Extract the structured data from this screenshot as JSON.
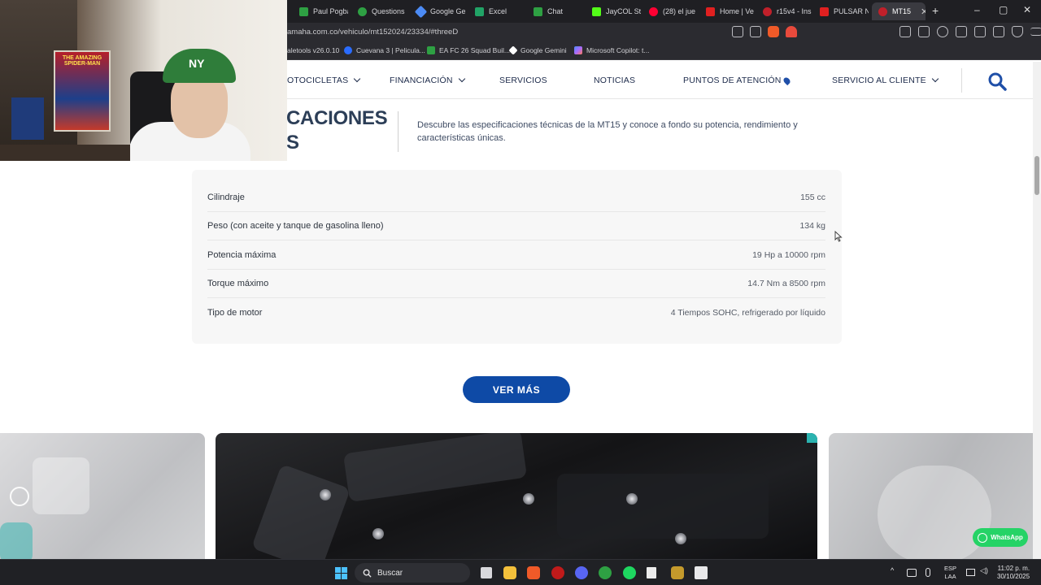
{
  "browser": {
    "tabs": [
      {
        "title": "Paul Pogba",
        "color": "#2ea043"
      },
      {
        "title": "Questions",
        "color": "#2ea043"
      },
      {
        "title": "Google Ge",
        "color": "#4c8bf5"
      },
      {
        "title": "Excel",
        "color": "#21a366"
      },
      {
        "title": "Chat",
        "color": "#2ea043"
      },
      {
        "title": "JayCOL St",
        "color": "#53fc18"
      },
      {
        "title": "(28) el jue",
        "color": "#ff0033"
      },
      {
        "title": "Home | Ve",
        "color": "#e02020"
      },
      {
        "title": "r15v4 - Ins",
        "color": "#c0202a"
      },
      {
        "title": "PULSAR N",
        "color": "#e02020"
      },
      {
        "title": "MT15",
        "color": "#c0202a"
      }
    ],
    "new_tab": "+",
    "url": "amaha.com.co/vehiculo/mt152024/23334/#threeD",
    "bookmarks": [
      {
        "label": "aletools v26.0.10",
        "color": "#4a8cff"
      },
      {
        "label": "Cuevana 3 | Pelicula...",
        "color": "#2a6cff"
      },
      {
        "label": "EA FC 26 Squad Buil...",
        "color": "#2ea043"
      },
      {
        "label": "Google Gemini",
        "color": "#ffffff"
      },
      {
        "label": "Microsoft Copilot: t...",
        "color": "#a86bff"
      }
    ]
  },
  "nav": {
    "items": [
      {
        "label": "OTOCICLETAS",
        "dropdown": true
      },
      {
        "label": "FINANCIACIÓN",
        "dropdown": true
      },
      {
        "label": "SERVICIOS",
        "dropdown": false
      },
      {
        "label": "NOTICIAS",
        "dropdown": false
      },
      {
        "label": "PUNTOS DE ATENCIÓN",
        "dropdown": false,
        "pin": true
      },
      {
        "label": "SERVICIO AL CLIENTE",
        "dropdown": true
      }
    ],
    "accent": "#1f4fa8"
  },
  "section": {
    "title_line1": "CACIONES",
    "title_line2": "S",
    "description": "Descubre las especificaciones técnicas de la MT15 y conoce a fondo su potencia, rendimiento y características únicas."
  },
  "specs": [
    {
      "label": "Cilindraje",
      "value": "155 cc"
    },
    {
      "label": "Peso (con aceite y tanque de gasolina lleno)",
      "value": "134 kg"
    },
    {
      "label": "Potencia máxima",
      "value": "19 Hp a 10000 rpm"
    },
    {
      "label": "Torque máximo",
      "value": "14.7 Nm a 8500 rpm"
    },
    {
      "label": "Tipo de motor",
      "value": "4 Tiempos SOHC, refrigerado por líquido"
    }
  ],
  "cta": {
    "ver_mas": "VER MÁS",
    "color": "#0e4aa6"
  },
  "whatsapp": {
    "label": "WhatsApp",
    "color": "#25d366"
  },
  "webcam": {
    "poster_text": "THE AMAZING SPIDER-MAN",
    "cap_logo": "NY"
  },
  "taskbar": {
    "search_label": "Buscar",
    "lang_line1": "ESP",
    "lang_line2": "LAA",
    "time": "11:02 p. m.",
    "date": "30/10/2025"
  }
}
